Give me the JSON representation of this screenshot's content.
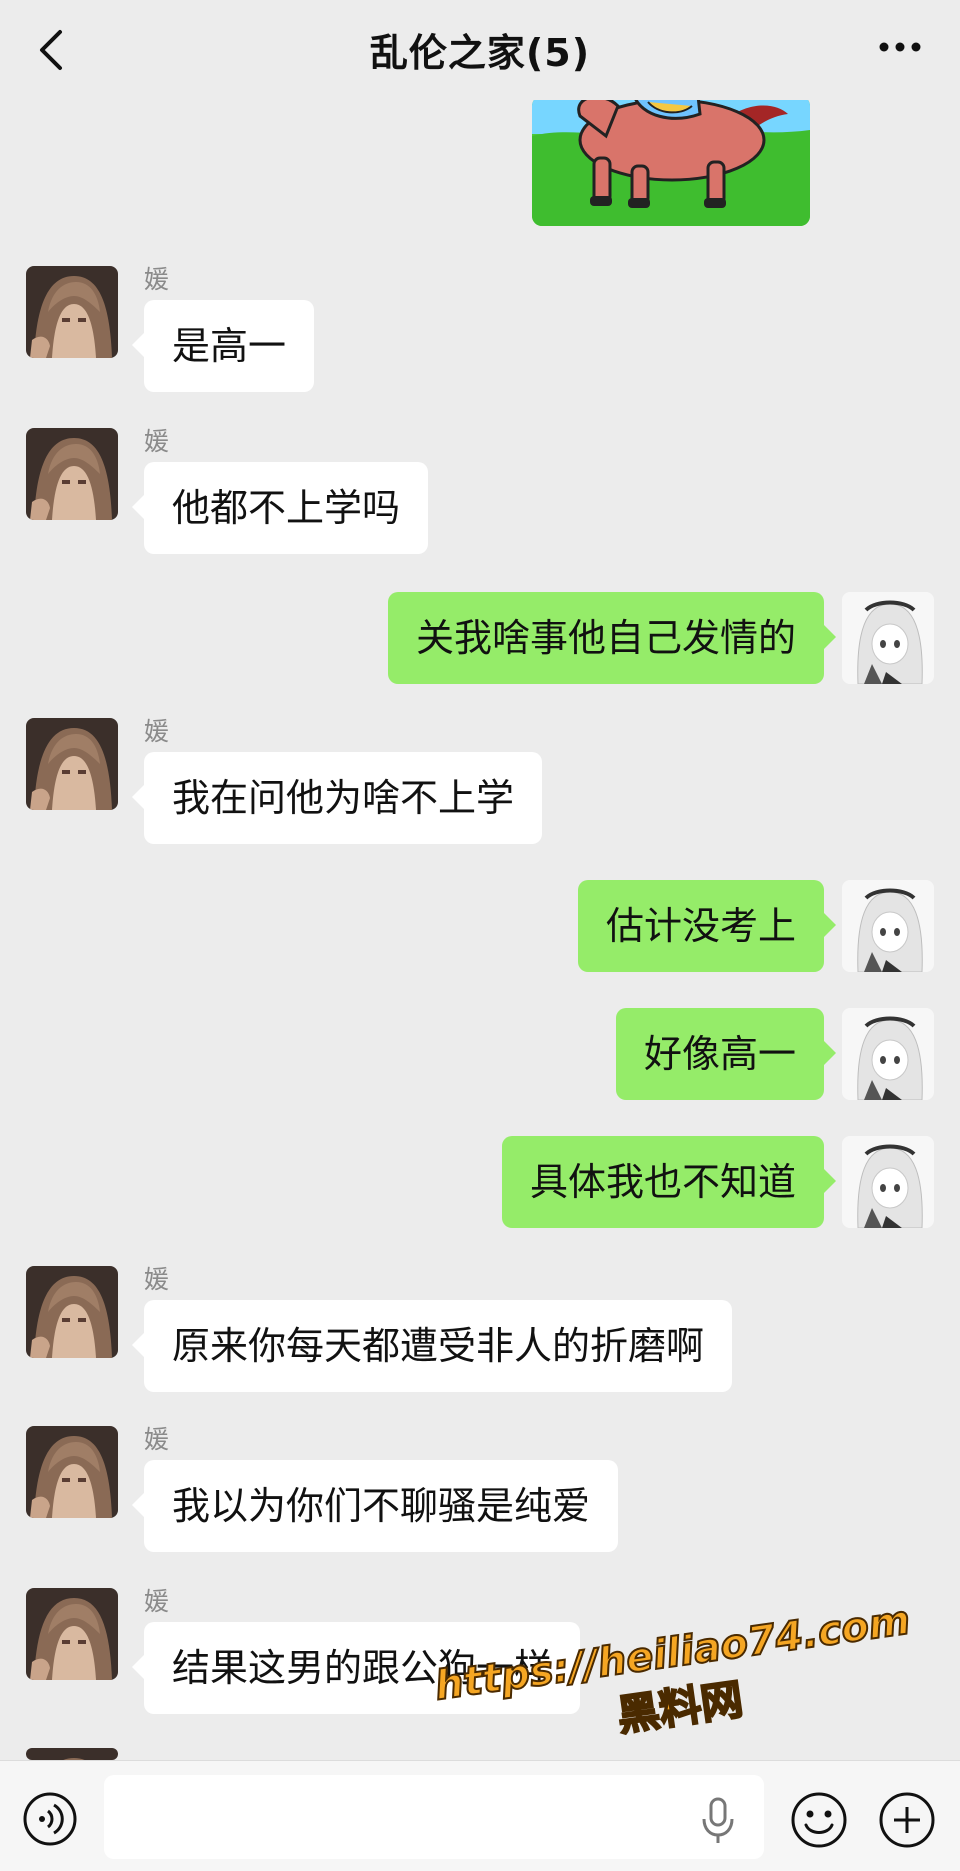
{
  "header": {
    "title": "乱伦之家(5)"
  },
  "messages": [
    {
      "side": "in",
      "sender": "媛",
      "text": "是高一"
    },
    {
      "side": "in",
      "sender": "媛",
      "text": "他都不上学吗"
    },
    {
      "side": "out",
      "text": "关我啥事他自己发情的"
    },
    {
      "side": "in",
      "sender": "媛",
      "text": "我在问他为啥不上学"
    },
    {
      "side": "out",
      "text": "估计没考上"
    },
    {
      "side": "out",
      "text": "好像高一"
    },
    {
      "side": "out",
      "text": "具体我也不知道"
    },
    {
      "side": "in",
      "sender": "媛",
      "text": "原来你每天都遭受非人的折磨啊"
    },
    {
      "side": "in",
      "sender": "媛",
      "text": "我以为你们不聊骚是纯爱"
    },
    {
      "side": "in",
      "sender": "媛",
      "text": "结果这男的跟公狗一样"
    }
  ],
  "footer": {
    "input_value": ""
  },
  "watermark": {
    "url": "https://heiliao74.com",
    "name": "黑料网"
  },
  "icons": {
    "back": "chevron-left-icon",
    "more": "more-dots-icon",
    "voice": "voice-icon",
    "mic": "microphone-icon",
    "emoji": "emoji-icon",
    "plus": "plus-icon"
  },
  "colors": {
    "background": "#ececec",
    "outgoing_bubble": "#95ec69",
    "incoming_bubble": "#ffffff"
  }
}
